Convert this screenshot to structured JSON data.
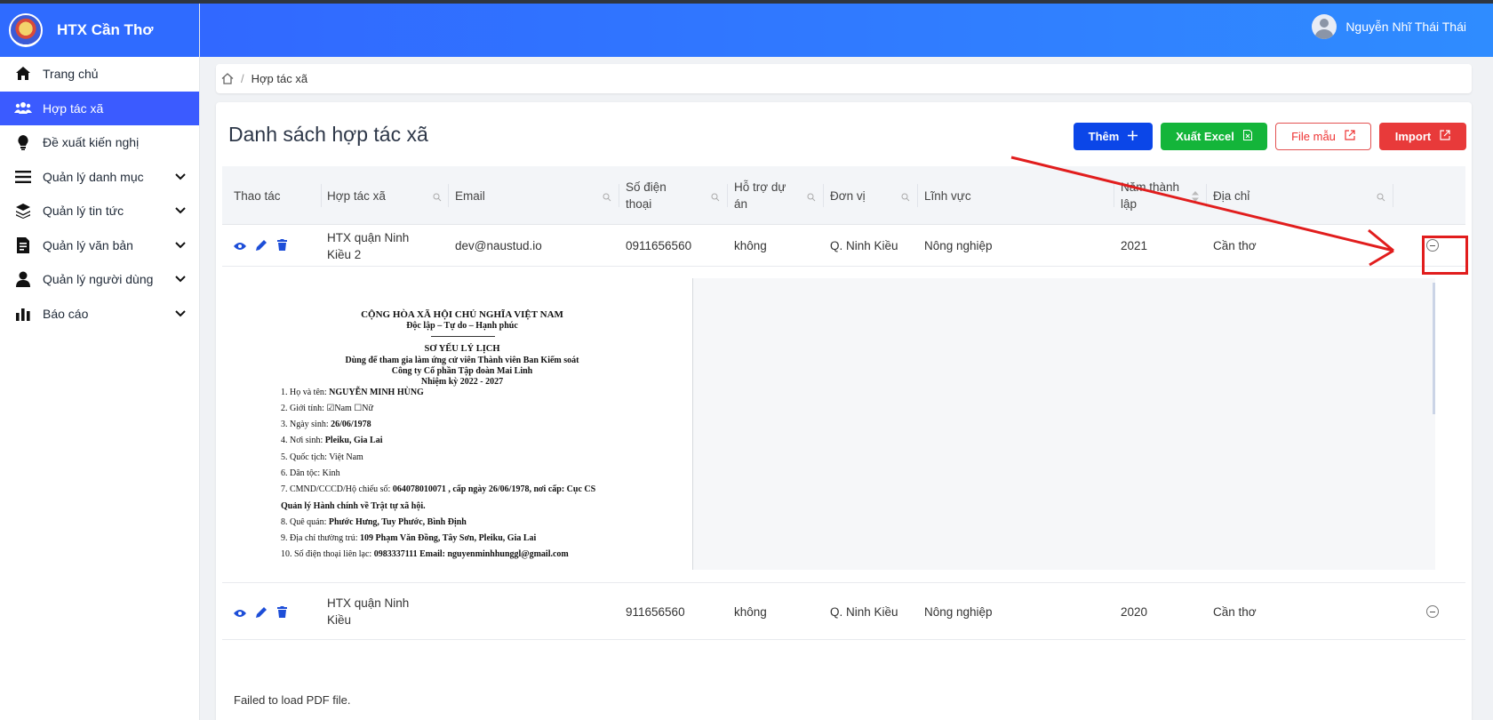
{
  "app": {
    "title": "HTX Cần Thơ",
    "user_name": "Nguyễn Nhĩ Thái Thái"
  },
  "sidebar": {
    "items": [
      {
        "label": "Trang chủ",
        "icon": "home-icon",
        "active": false,
        "expandable": false
      },
      {
        "label": "Hợp tác xã",
        "icon": "users-icon",
        "active": true,
        "expandable": false
      },
      {
        "label": "Đề xuất kiến nghị",
        "icon": "lightbulb-icon",
        "active": false,
        "expandable": false
      },
      {
        "label": "Quản lý danh mục",
        "icon": "list-icon",
        "active": false,
        "expandable": true
      },
      {
        "label": "Quản lý tin tức",
        "icon": "layers-icon",
        "active": false,
        "expandable": true
      },
      {
        "label": "Quản lý văn bản",
        "icon": "document-icon",
        "active": false,
        "expandable": true
      },
      {
        "label": "Quản lý người dùng",
        "icon": "user-icon",
        "active": false,
        "expandable": true
      },
      {
        "label": "Báo cáo",
        "icon": "bar-chart-icon",
        "active": false,
        "expandable": true
      }
    ]
  },
  "breadcrumb": {
    "current": "Hợp tác xã",
    "separator": "/"
  },
  "page": {
    "title": "Danh sách hợp tác xã"
  },
  "toolbar": {
    "add_label": "Thêm",
    "export_label": "Xuất Excel",
    "template_label": "File mẫu",
    "import_label": "Import"
  },
  "table": {
    "columns": {
      "actions": "Thao tác",
      "coop": "Hợp tác xã",
      "email": "Email",
      "phone": "Số điện thoại",
      "support": "Hỗ trợ dự án",
      "unit": "Đơn vị",
      "field": "Lĩnh vực",
      "year": "Năm thành lập",
      "address": "Địa chỉ"
    },
    "rows": [
      {
        "coop": "HTX quận Ninh Kiều 2",
        "email": "dev@naustud.io",
        "phone": "0911656560",
        "support": "không",
        "unit": "Q. Ninh Kiều",
        "field": "Nông nghiệp",
        "year": "2021",
        "address": "Cần thơ"
      },
      {
        "coop": "HTX quận Ninh Kiều",
        "email": "",
        "phone": "911656560",
        "support": "không",
        "unit": "Q. Ninh Kiều",
        "field": "Nông nghiệp",
        "year": "2020",
        "address": "Cần thơ"
      }
    ]
  },
  "document_preview": {
    "header1": "CỘNG HÒA XÃ HỘI CHỦ NGHĨA VIỆT NAM",
    "header2": "Độc lập – Tự do – Hạnh phúc",
    "title": "SƠ YẾU LÝ LỊCH",
    "sub1": "Dùng để tham gia làm ứng cử viên Thành viên Ban Kiểm soát",
    "sub2": "Công ty Cổ phần Tập đoàn Mai Linh",
    "sub3": "Nhiệm kỳ 2022 - 2027",
    "lines": [
      {
        "label": "1.  Họ và tên: ",
        "value": "NGUYỄN MINH HÙNG"
      },
      {
        "label": "2.  Giới tính: ",
        "value": "☑Nam ☐Nữ"
      },
      {
        "label": "3.  Ngày sinh: ",
        "value": "26/06/1978"
      },
      {
        "label": "4.  Nơi sinh: ",
        "value": "Pleiku, Gia Lai"
      },
      {
        "label": "5.  Quốc tịch: ",
        "value": "Việt Nam"
      },
      {
        "label": "6.  Dân tộc: ",
        "value": "Kinh"
      },
      {
        "label": "7.  CMND/CCCD/Hộ chiếu số:  ",
        "value": "064078010071 , cấp ngày 26/06/1978, nơi cấp: Cục CS"
      },
      {
        "label": "    ",
        "value": "Quản lý Hành chính về Trật tự xã hội."
      },
      {
        "label": "8.  Quê quán: ",
        "value": "Phước Hưng, Tuy Phước, Bình Định"
      },
      {
        "label": "9.  Địa chỉ thường trú: ",
        "value": "109 Phạm Văn Đồng, Tây Sơn, Pleiku, Gia Lai"
      },
      {
        "label": "10. Số điện thoại liên lạc: ",
        "value": "0983337111          Email: nguyenminhhunggl@gmail.com"
      }
    ]
  },
  "second_preview": {
    "message": "Failed to load PDF file."
  },
  "annotation": {
    "color": "#e11d1d"
  }
}
